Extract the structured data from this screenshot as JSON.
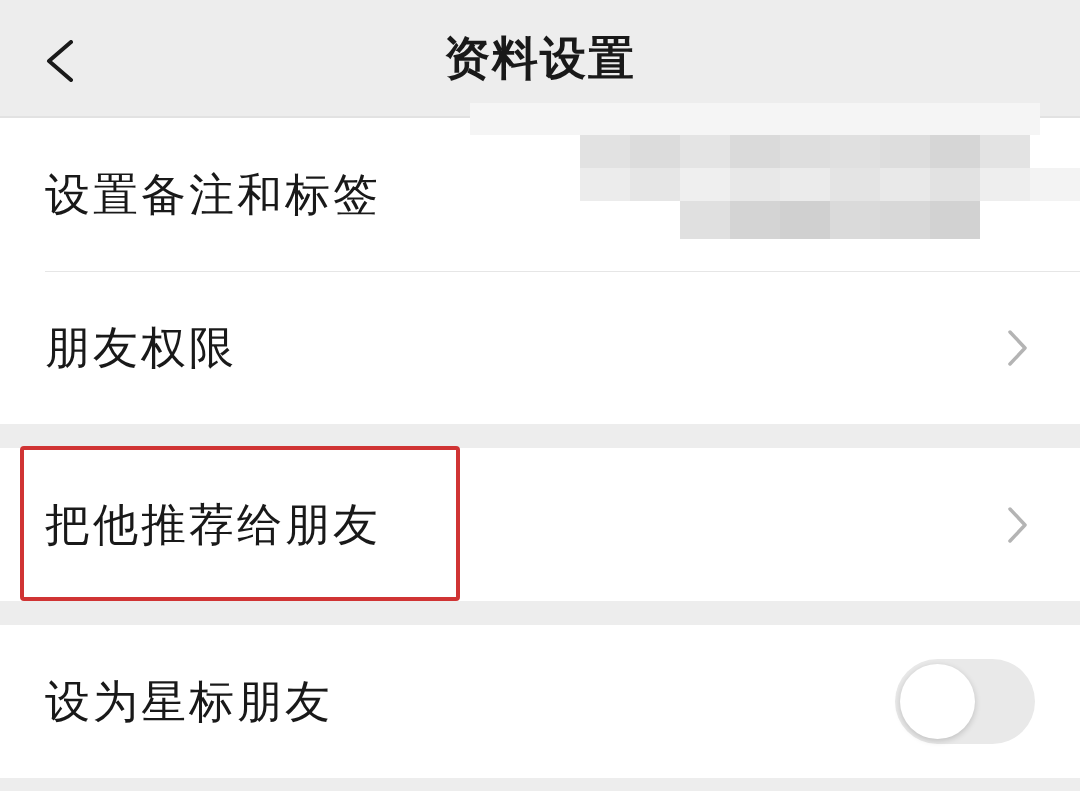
{
  "header": {
    "title": "资料设置"
  },
  "groups": [
    {
      "rows": [
        {
          "label": "设置备注和标签",
          "kind": "plain",
          "highlighted": false
        },
        {
          "label": "朋友权限",
          "kind": "chevron",
          "highlighted": false
        }
      ]
    },
    {
      "rows": [
        {
          "label": "把他推荐给朋友",
          "kind": "chevron",
          "highlighted": true
        }
      ]
    },
    {
      "rows": [
        {
          "label": "设为星标朋友",
          "kind": "toggle",
          "highlighted": false,
          "on": false
        }
      ]
    }
  ]
}
